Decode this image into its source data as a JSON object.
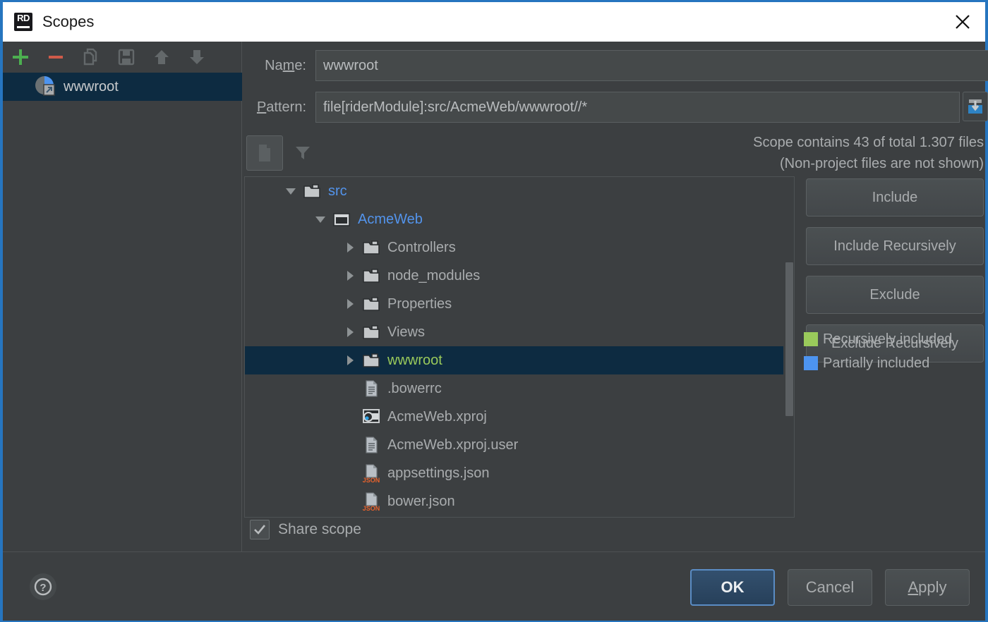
{
  "window": {
    "title": "Scopes",
    "logo_text": "RD",
    "close_icon": "close-icon"
  },
  "left_panel": {
    "toolbar": [
      {
        "name": "add-scope-button",
        "icon": "plus-icon",
        "color": "#4caf50"
      },
      {
        "name": "remove-scope-button",
        "icon": "minus-icon",
        "color": "#cf5b4a"
      },
      {
        "name": "copy-scope-button",
        "icon": "copy-icon",
        "color": "#63686a"
      },
      {
        "name": "save-scope-button",
        "icon": "save-icon",
        "color": "#63686a"
      },
      {
        "name": "move-up-button",
        "icon": "arrow-up-icon",
        "color": "#63686a"
      },
      {
        "name": "move-down-button",
        "icon": "arrow-down-icon",
        "color": "#63686a"
      }
    ],
    "scopes": [
      {
        "label": "wwwroot",
        "icon": "scope-pie-icon",
        "selected": true
      }
    ]
  },
  "form": {
    "name_label_pre": "Na",
    "name_label_mn": "m",
    "name_label_post": "e:",
    "name_value": "wwwroot",
    "pattern_label_mn": "P",
    "pattern_label_post": "attern:",
    "pattern_value": "file[riderModule]:src/AcmeWeb/wwwroot//*",
    "pattern_action_icon": "import-into-box-icon",
    "toggle_icon": "show-files-icon",
    "filter_icon": "filter-funnel-icon",
    "info_line1": "Scope contains 43 of total 1.307 files",
    "info_line2": "(Non-project files are not shown)"
  },
  "tree": [
    {
      "label": "src",
      "indent": 0,
      "arrow": "down",
      "icon": "folder-icon",
      "color": "blue",
      "selected": false
    },
    {
      "label": "AcmeWeb",
      "indent": 1,
      "arrow": "down",
      "icon": "module-icon",
      "color": "blue",
      "selected": false
    },
    {
      "label": "Controllers",
      "indent": 2,
      "arrow": "right",
      "icon": "folder-icon",
      "color": "gray",
      "selected": false
    },
    {
      "label": "node_modules",
      "indent": 2,
      "arrow": "right",
      "icon": "folder-icon",
      "color": "gray",
      "selected": false
    },
    {
      "label": "Properties",
      "indent": 2,
      "arrow": "right",
      "icon": "folder-icon",
      "color": "gray",
      "selected": false
    },
    {
      "label": "Views",
      "indent": 2,
      "arrow": "right",
      "icon": "folder-icon",
      "color": "gray",
      "selected": false
    },
    {
      "label": "wwwroot",
      "indent": 2,
      "arrow": "right",
      "icon": "folder-icon",
      "color": "green",
      "selected": true
    },
    {
      "label": ".bowerrc",
      "indent": 2,
      "arrow": "none",
      "icon": "text-file-icon",
      "color": "gray",
      "selected": false
    },
    {
      "label": "AcmeWeb.xproj",
      "indent": 2,
      "arrow": "none",
      "icon": "xproj-icon",
      "color": "gray",
      "selected": false
    },
    {
      "label": "AcmeWeb.xproj.user",
      "indent": 2,
      "arrow": "none",
      "icon": "text-file-icon",
      "color": "gray",
      "selected": false
    },
    {
      "label": "appsettings.json",
      "indent": 2,
      "arrow": "none",
      "icon": "json-file-icon",
      "color": "gray",
      "selected": false
    },
    {
      "label": "bower.json",
      "indent": 2,
      "arrow": "none",
      "icon": "json-file-icon",
      "color": "gray",
      "selected": false
    }
  ],
  "side_buttons": [
    {
      "label": "Include"
    },
    {
      "label": "Include Recursively"
    },
    {
      "label": "Exclude"
    },
    {
      "label": "Exclude Recursively"
    }
  ],
  "legend": [
    {
      "label": "Recursively included",
      "color": "#9aca5b"
    },
    {
      "label": "Partially included",
      "color": "#4d94f0"
    }
  ],
  "share_scope": {
    "label": "Share scope",
    "checked": true
  },
  "footer": {
    "help_icon": "help-question-icon",
    "ok_label": "OK",
    "cancel_label": "Cancel",
    "apply_label_mn": "A",
    "apply_label_post": "pply"
  },
  "colors": {
    "accent_border": "#2675bf",
    "selection": "#0d2b41",
    "panel_bg": "#3c3f41",
    "text": "#a9acae",
    "blue_text": "#5394ec",
    "green_text": "#9aca5b"
  }
}
